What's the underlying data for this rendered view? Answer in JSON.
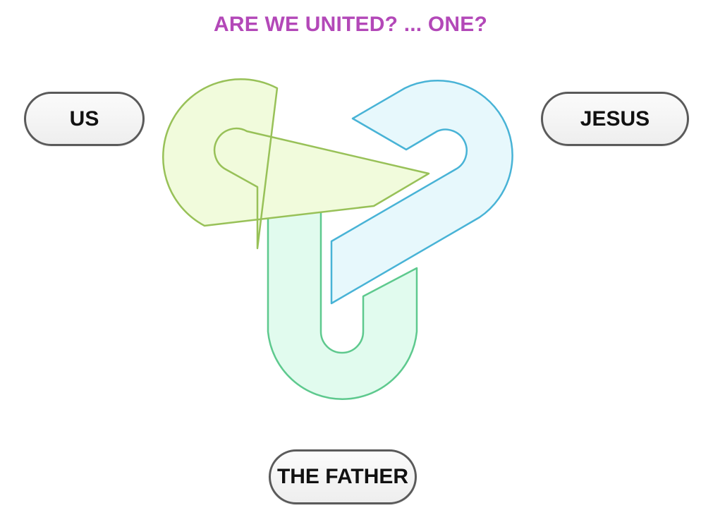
{
  "title": {
    "text": "ARE WE UNITED? ... ONE?",
    "color": "#b348b8"
  },
  "labels": {
    "us": "US",
    "jesus": "JESUS",
    "the_father": "THE FATHER"
  },
  "knot": {
    "icon": "trinity-knot-icon",
    "colors": {
      "us_loop": {
        "fill": "#f1fbdc",
        "stroke": "#98c158"
      },
      "jesus_loop": {
        "fill": "#e7f8fc",
        "stroke": "#48b3d6"
      },
      "father_loop": {
        "fill": "#e1fbee",
        "stroke": "#5ec98e"
      }
    }
  }
}
